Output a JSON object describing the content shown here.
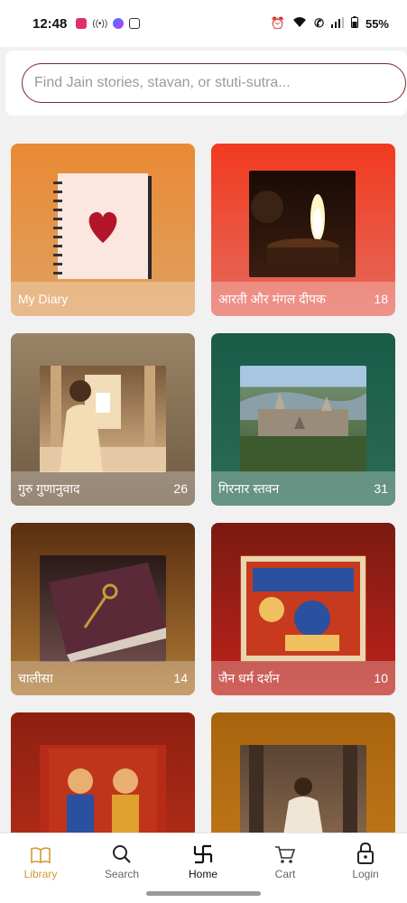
{
  "status": {
    "time": "12:48",
    "battery": "55%"
  },
  "search": {
    "placeholder": "Find Jain stories, stavan, or stuti-sutra..."
  },
  "cards": [
    {
      "label": "My Diary",
      "count": "",
      "bg": "#e58a2f",
      "img": "diary"
    },
    {
      "label": "आरती और मंगल दीपक",
      "count": "18",
      "bg": "#e33425",
      "img": "lamp"
    },
    {
      "label": "गुरु गुणानुवाद",
      "count": "26",
      "bg": "#8a7257",
      "img": "temple"
    },
    {
      "label": "गिरनार स्तवन",
      "count": "31",
      "bg": "#1e5b46",
      "img": "mountain"
    },
    {
      "label": "चालीसा",
      "count": "14",
      "bg": "#6b3a14",
      "img": "book"
    },
    {
      "label": "जैन धर्म दर्शन",
      "count": "10",
      "bg": "#8a1c12",
      "img": "painting"
    },
    {
      "label": "",
      "count": "",
      "bg": "#8e1f10",
      "img": "painting2"
    },
    {
      "label": "",
      "count": "",
      "bg": "#9a5a12",
      "img": "monk"
    }
  ],
  "nav": {
    "library": "Library",
    "search": "Search",
    "home": "Home",
    "cart": "Cart",
    "login": "Login"
  },
  "colors": {
    "accent": "#d39a2f",
    "search_border": "#7a2a2a"
  }
}
